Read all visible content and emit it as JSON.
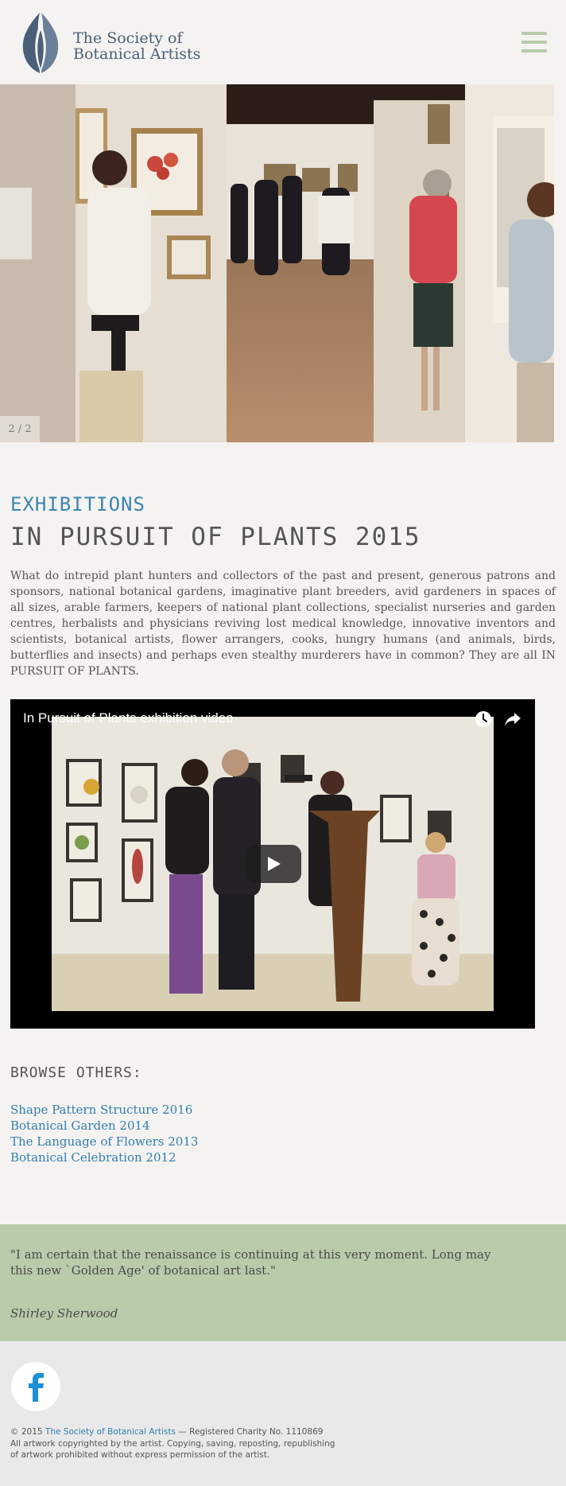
{
  "header": {
    "brand_line1": "The Society of",
    "brand_line2": "Botanical Artists",
    "menu_icon": "hamburger-menu-icon"
  },
  "slideshow": {
    "counter": "2 / 2"
  },
  "page": {
    "eyebrow": "EXHIBITIONS",
    "title": "IN PURSUIT OF PLANTS 2015",
    "intro": "What do intrepid plant hunters and collectors of the past and present, generous patrons and sponsors, national botanical gardens, imaginative plant breeders, avid gardeners in spaces of all sizes, arable farmers, keepers of national plant collections, specialist nurseries and garden centres, herbalists and physicians reviving lost medical knowledge, innovative inventors and scientists, botanical artists, flower arrangers, cooks, hungry humans (and animals, birds, butterflies and insects) and perhaps even stealthy murderers have in common? They are all IN PURSUIT OF PLANTS."
  },
  "video": {
    "title": "In Pursuit of Plants exhibition video",
    "watch_later_icon": "clock-icon",
    "share_icon": "share-icon",
    "play_icon": "play-icon"
  },
  "browse": {
    "heading": "BROWSE OTHERS:",
    "links": [
      "Shape Pattern Structure 2016",
      "Botanical Garden 2014",
      "The Language of Flowers 2013",
      "Botanical Celebration 2012"
    ]
  },
  "quote": {
    "text": "\"I am certain that the renaissance is continuing at this very moment. Long may this new `Golden Age' of botanical art last.\"",
    "author": "Shirley Sherwood"
  },
  "footer": {
    "facebook_icon": "facebook-icon",
    "copyright_prefix": "© 2015 ",
    "org_link": "The Society of Botanical Artists",
    "copyright_suffix": " — Registered Charity No. 1110869",
    "line2": "All artwork copyrighted by the artist. Copying, saving, reposting, republishing",
    "line3": "of artwork prohibited without express permission of the artist."
  },
  "colors": {
    "accent_blue": "#2f7fb0",
    "quote_green": "#b9cbab",
    "menu_green": "#b7cbab"
  }
}
